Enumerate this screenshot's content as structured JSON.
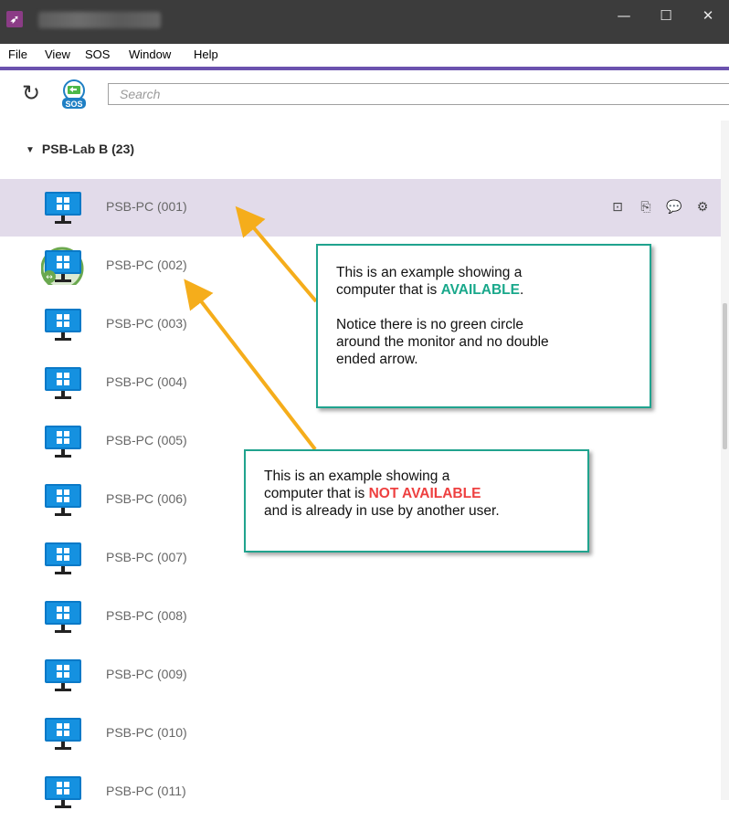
{
  "window": {
    "title_blurred": true,
    "minimize": "—",
    "maximize": "☐",
    "close": "✕"
  },
  "menu": [
    "File",
    "View",
    "SOS",
    "Window",
    "Help"
  ],
  "toolbar": {
    "search_placeholder": "Search",
    "sos_label": "SOS"
  },
  "group": {
    "caret": "▼",
    "name": "PSB-Lab B (23)"
  },
  "computers": [
    {
      "name": "PSB-PC (001)",
      "status": "available",
      "selected": true
    },
    {
      "name": "PSB-PC (002)",
      "status": "in-use",
      "selected": false
    },
    {
      "name": "PSB-PC (003)",
      "status": "available",
      "selected": false
    },
    {
      "name": "PSB-PC (004)",
      "status": "available",
      "selected": false
    },
    {
      "name": "PSB-PC (005)",
      "status": "available",
      "selected": false
    },
    {
      "name": "PSB-PC (006)",
      "status": "available",
      "selected": false
    },
    {
      "name": "PSB-PC (007)",
      "status": "available",
      "selected": false
    },
    {
      "name": "PSB-PC (008)",
      "status": "available",
      "selected": false
    },
    {
      "name": "PSB-PC (009)",
      "status": "available",
      "selected": false
    },
    {
      "name": "PSB-PC (010)",
      "status": "available",
      "selected": false
    },
    {
      "name": "PSB-PC (011)",
      "status": "available",
      "selected": false
    }
  ],
  "row_actions": [
    "remote-control-icon",
    "file-transfer-icon",
    "chat-icon",
    "settings-gear-icon"
  ],
  "annotations": {
    "available": {
      "line1": "This is an example showing a",
      "line2_prefix": "computer that is ",
      "keyword": "AVAILABLE",
      "line2_suffix": ".",
      "line3": "Notice there is no green circle",
      "line4": "around the monitor and no double",
      "line5": "ended arrow."
    },
    "not_available": {
      "line1": "This is an example showing a",
      "line2_prefix": "computer that is ",
      "keyword": "NOT AVAILABLE",
      "line3": "and is already in use by another user."
    }
  },
  "colors": {
    "accent": "#6b52ae",
    "selected_row": "#e2dbea",
    "callout_border": "#20a38e",
    "available_text": "#19a88b",
    "not_available_text": "#ee4040",
    "arrow": "#f5ad1b",
    "in_use_ring": "#6aa84f"
  }
}
